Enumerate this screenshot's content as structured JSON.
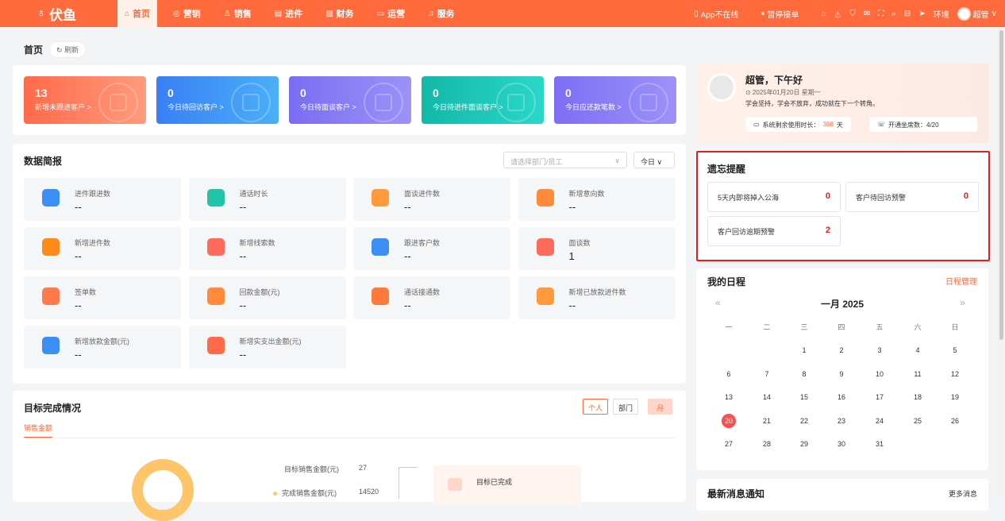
{
  "app": {
    "logo": "伏鱼"
  },
  "nav": [
    {
      "label": "首页",
      "icon": "⌂"
    },
    {
      "label": "营销",
      "icon": "◎"
    },
    {
      "label": "销售",
      "icon": "♙"
    },
    {
      "label": "进件",
      "icon": "▤"
    },
    {
      "label": "财务",
      "icon": "▧"
    },
    {
      "label": "运营",
      "icon": "▭"
    },
    {
      "label": "服务",
      "icon": "♫"
    }
  ],
  "topright": {
    "app_status": "App不在线",
    "pause": "暂停接单",
    "env": "环境",
    "user": "超管"
  },
  "crumb": {
    "title": "首页",
    "refresh": "刷新"
  },
  "stats": [
    {
      "value": "13",
      "label": "新增未跟进客户 >"
    },
    {
      "value": "0",
      "label": "今日待回访客户 >"
    },
    {
      "value": "0",
      "label": "今日待面谈客户 >"
    },
    {
      "value": "0",
      "label": "今日待进件面谈客户 >"
    },
    {
      "value": "0",
      "label": "今日应还款笔数 >"
    }
  ],
  "report": {
    "title": "数据简报",
    "dept_placeholder": "请选择部门/员工",
    "date": "今日 ∨",
    "cells": [
      {
        "label": "进件跟进数",
        "value": "--"
      },
      {
        "label": "通话时长",
        "value": "--"
      },
      {
        "label": "面谈进件数",
        "value": "--"
      },
      {
        "label": "新增意向数",
        "value": "--"
      },
      {
        "label": "新增进件数",
        "value": "--"
      },
      {
        "label": "新增线索数",
        "value": "--"
      },
      {
        "label": "跟进客户数",
        "value": "--"
      },
      {
        "label": "面谈数",
        "value": "1"
      },
      {
        "label": "签单数",
        "value": "--"
      },
      {
        "label": "回款金额(元)",
        "value": "--"
      },
      {
        "label": "通话接通数",
        "value": "--"
      },
      {
        "label": "新增已放款进件数",
        "value": "--"
      },
      {
        "label": "新增放款金额(元)",
        "value": "--"
      },
      {
        "label": "新增实支出金额(元)",
        "value": "--"
      }
    ]
  },
  "goal": {
    "title": "目标完成情况",
    "tab_personal": "个人",
    "tab_dept": "部门",
    "tab_month": "月",
    "sub": "销售金额",
    "target_label": "目标销售金额(元)",
    "target_value": "27",
    "done_label": "完成销售金额(元)",
    "done_value": "14520",
    "card_label": "目标已完成"
  },
  "user": {
    "greeting": "超管，下午好",
    "date": "⊙ 2025年01月20日 星期一",
    "motto": "学会坚持，学会不放弃，成功就在下一个转角。",
    "remain_label": "系统剩余使用时长：",
    "remain_value": "368",
    "remain_unit": "天",
    "seats_label": "开通坐席数：4/20"
  },
  "memo": {
    "title": "遗忘提醒",
    "items": [
      {
        "label": "5天内即将掉入公海",
        "count": "0"
      },
      {
        "label": "客户待回访预警",
        "count": "0"
      },
      {
        "label": "客户回访逾期预警",
        "count": "2"
      }
    ]
  },
  "schedule": {
    "title": "我的日程",
    "manage": "日程管理",
    "month": "一月 2025",
    "prev": "«",
    "next": "»",
    "weekdays": [
      "一",
      "二",
      "三",
      "四",
      "五",
      "六",
      "日"
    ],
    "weeks": [
      [
        "",
        "",
        "1",
        "2",
        "3",
        "4",
        "5"
      ],
      [
        "6",
        "7",
        "8",
        "9",
        "10",
        "11",
        "12"
      ],
      [
        "13",
        "14",
        "15",
        "16",
        "17",
        "18",
        "19"
      ],
      [
        "20",
        "21",
        "22",
        "23",
        "24",
        "25",
        "26"
      ],
      [
        "27",
        "28",
        "29",
        "30",
        "31",
        "",
        ""
      ]
    ],
    "today": "20"
  },
  "news": {
    "title": "最新消息通知",
    "more": "更多消息"
  },
  "colors": {
    "brand": "#ff6a3d",
    "stat1": "#ff7a5a",
    "stat2": "#3a8ff5",
    "stat3": "#8277f5",
    "stat4": "#1cc3b2",
    "stat5": "#8a7bf7",
    "alert": "#e02020"
  }
}
